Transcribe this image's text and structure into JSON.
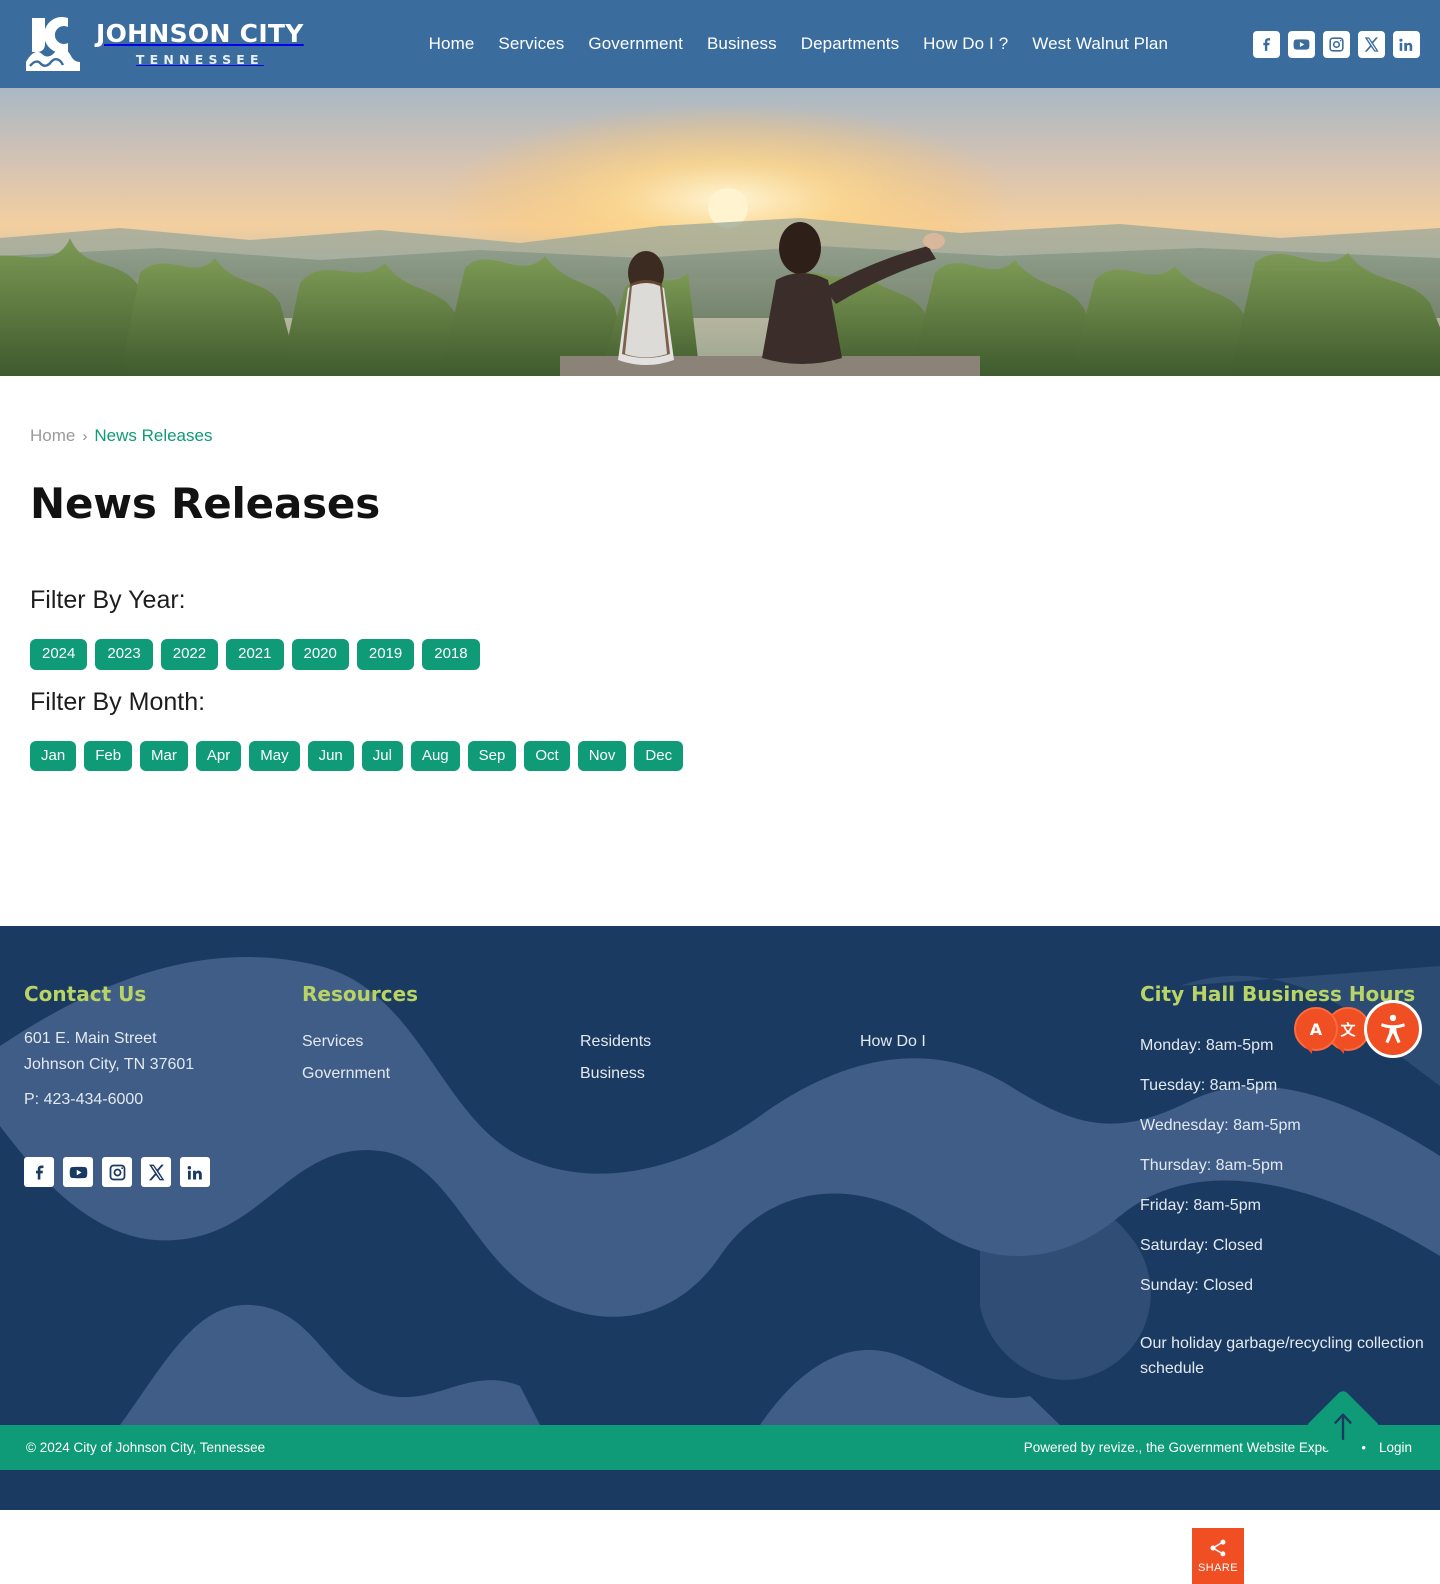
{
  "header": {
    "logo": {
      "title": "JOHNSON CITY",
      "subtitle": "TENNESSEE",
      "icon": "jc-monogram-logo"
    },
    "nav": [
      {
        "label": "Home"
      },
      {
        "label": "Services"
      },
      {
        "label": "Government"
      },
      {
        "label": "Business"
      },
      {
        "label": "Departments"
      },
      {
        "label": "How Do I ?"
      },
      {
        "label": "West Walnut Plan"
      }
    ],
    "social": [
      {
        "name": "facebook-icon",
        "label": "Facebook"
      },
      {
        "name": "youtube-icon",
        "label": "YouTube"
      },
      {
        "name": "instagram-icon",
        "label": "Instagram"
      },
      {
        "name": "x-twitter-icon",
        "label": "X"
      },
      {
        "name": "linkedin-icon",
        "label": "LinkedIn"
      }
    ]
  },
  "hero": {
    "alt": "Two people sitting on an overlook watching the sunset over forested hills"
  },
  "breadcrumb": {
    "home": "Home",
    "separator": "›",
    "current": "News Releases"
  },
  "main": {
    "title": "News Releases",
    "filter_year_label": "Filter By Year:",
    "years": [
      "2024",
      "2023",
      "2022",
      "2021",
      "2020",
      "2019",
      "2018"
    ],
    "filter_month_label": "Filter By Month:",
    "months": [
      "Jan",
      "Feb",
      "Mar",
      "Apr",
      "May",
      "Jun",
      "Jul",
      "Aug",
      "Sep",
      "Oct",
      "Nov",
      "Dec"
    ]
  },
  "footer": {
    "contact": {
      "heading": "Contact Us",
      "address_line1": "601 E. Main Street",
      "address_line2": "Johnson City, TN 37601",
      "phone": "P: 423-434-6000"
    },
    "resources": {
      "heading": "Resources",
      "col1": [
        {
          "label": "Services"
        },
        {
          "label": "Government"
        }
      ],
      "col2": [
        {
          "label": "Residents"
        },
        {
          "label": "Business"
        }
      ],
      "col3": [
        {
          "label": "How Do I"
        }
      ]
    },
    "hours": {
      "heading": "City Hall Business Hours",
      "lines": [
        "Monday: 8am-5pm",
        "Tuesday: 8am-5pm",
        "Wednesday: 8am-5pm",
        "Thursday: 8am-5pm",
        "Friday: 8am-5pm",
        "Saturday: Closed",
        "Sunday: Closed"
      ],
      "note": "Our holiday garbage/recycling collection schedule"
    },
    "social": [
      {
        "name": "facebook-icon",
        "label": "Facebook"
      },
      {
        "name": "youtube-icon",
        "label": "YouTube"
      },
      {
        "name": "instagram-icon",
        "label": "Instagram"
      },
      {
        "name": "x-twitter-icon",
        "label": "X"
      },
      {
        "name": "linkedin-icon",
        "label": "LinkedIn"
      }
    ]
  },
  "widgets": {
    "translate_label": "Translate",
    "accessibility_label": "Accessibility",
    "scroll_top_label": "Back to top",
    "share_label": "SHARE"
  },
  "bottom_bar": {
    "copyright": "© 2024 City of Johnson City, Tennessee",
    "powered_by": "Powered by revize., the Government Website Experts.",
    "dot": "•",
    "login": "Login"
  },
  "colors": {
    "header_blue": "#3a6d9e",
    "accent_green": "#0f9b77",
    "footer_navy": "#1b3a61",
    "footer_wave": "#3f5d87",
    "lime_heading": "#b9d465",
    "orange": "#f04e23",
    "breadcrumb_muted": "#9a9a9a"
  }
}
